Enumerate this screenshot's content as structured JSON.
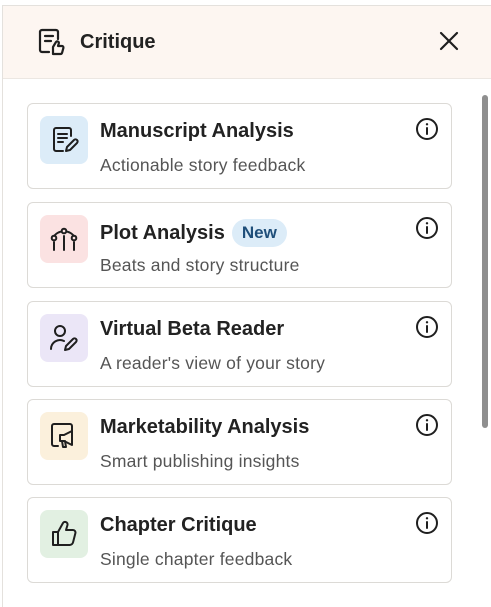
{
  "header": {
    "title": "Critique",
    "icon": "critique-document-thumb-icon",
    "close_icon": "close-icon"
  },
  "colors": {
    "header_bg": "#fdf6f1",
    "tile_blue": "#dcecf8",
    "tile_red": "#fbe2e2",
    "tile_purple": "#ebe6f7",
    "tile_yellow": "#fbf0dc",
    "tile_green": "#e2f0e2",
    "badge_bg": "#dcecf8"
  },
  "cards": [
    {
      "title": "Manuscript Analysis",
      "subtitle": "Actionable story feedback",
      "icon": "document-edit-icon",
      "badge": ""
    },
    {
      "title": "Plot Analysis",
      "subtitle": "Beats and story structure",
      "icon": "plot-arc-icon",
      "badge": "New"
    },
    {
      "title": "Virtual Beta Reader",
      "subtitle": "A reader's view of your story",
      "icon": "user-edit-icon",
      "badge": ""
    },
    {
      "title": "Marketability Analysis",
      "subtitle": "Smart publishing insights",
      "icon": "marketing-megaphone-icon",
      "badge": ""
    },
    {
      "title": "Chapter Critique",
      "subtitle": "Single chapter feedback",
      "icon": "thumbs-up-icon",
      "badge": ""
    }
  ]
}
